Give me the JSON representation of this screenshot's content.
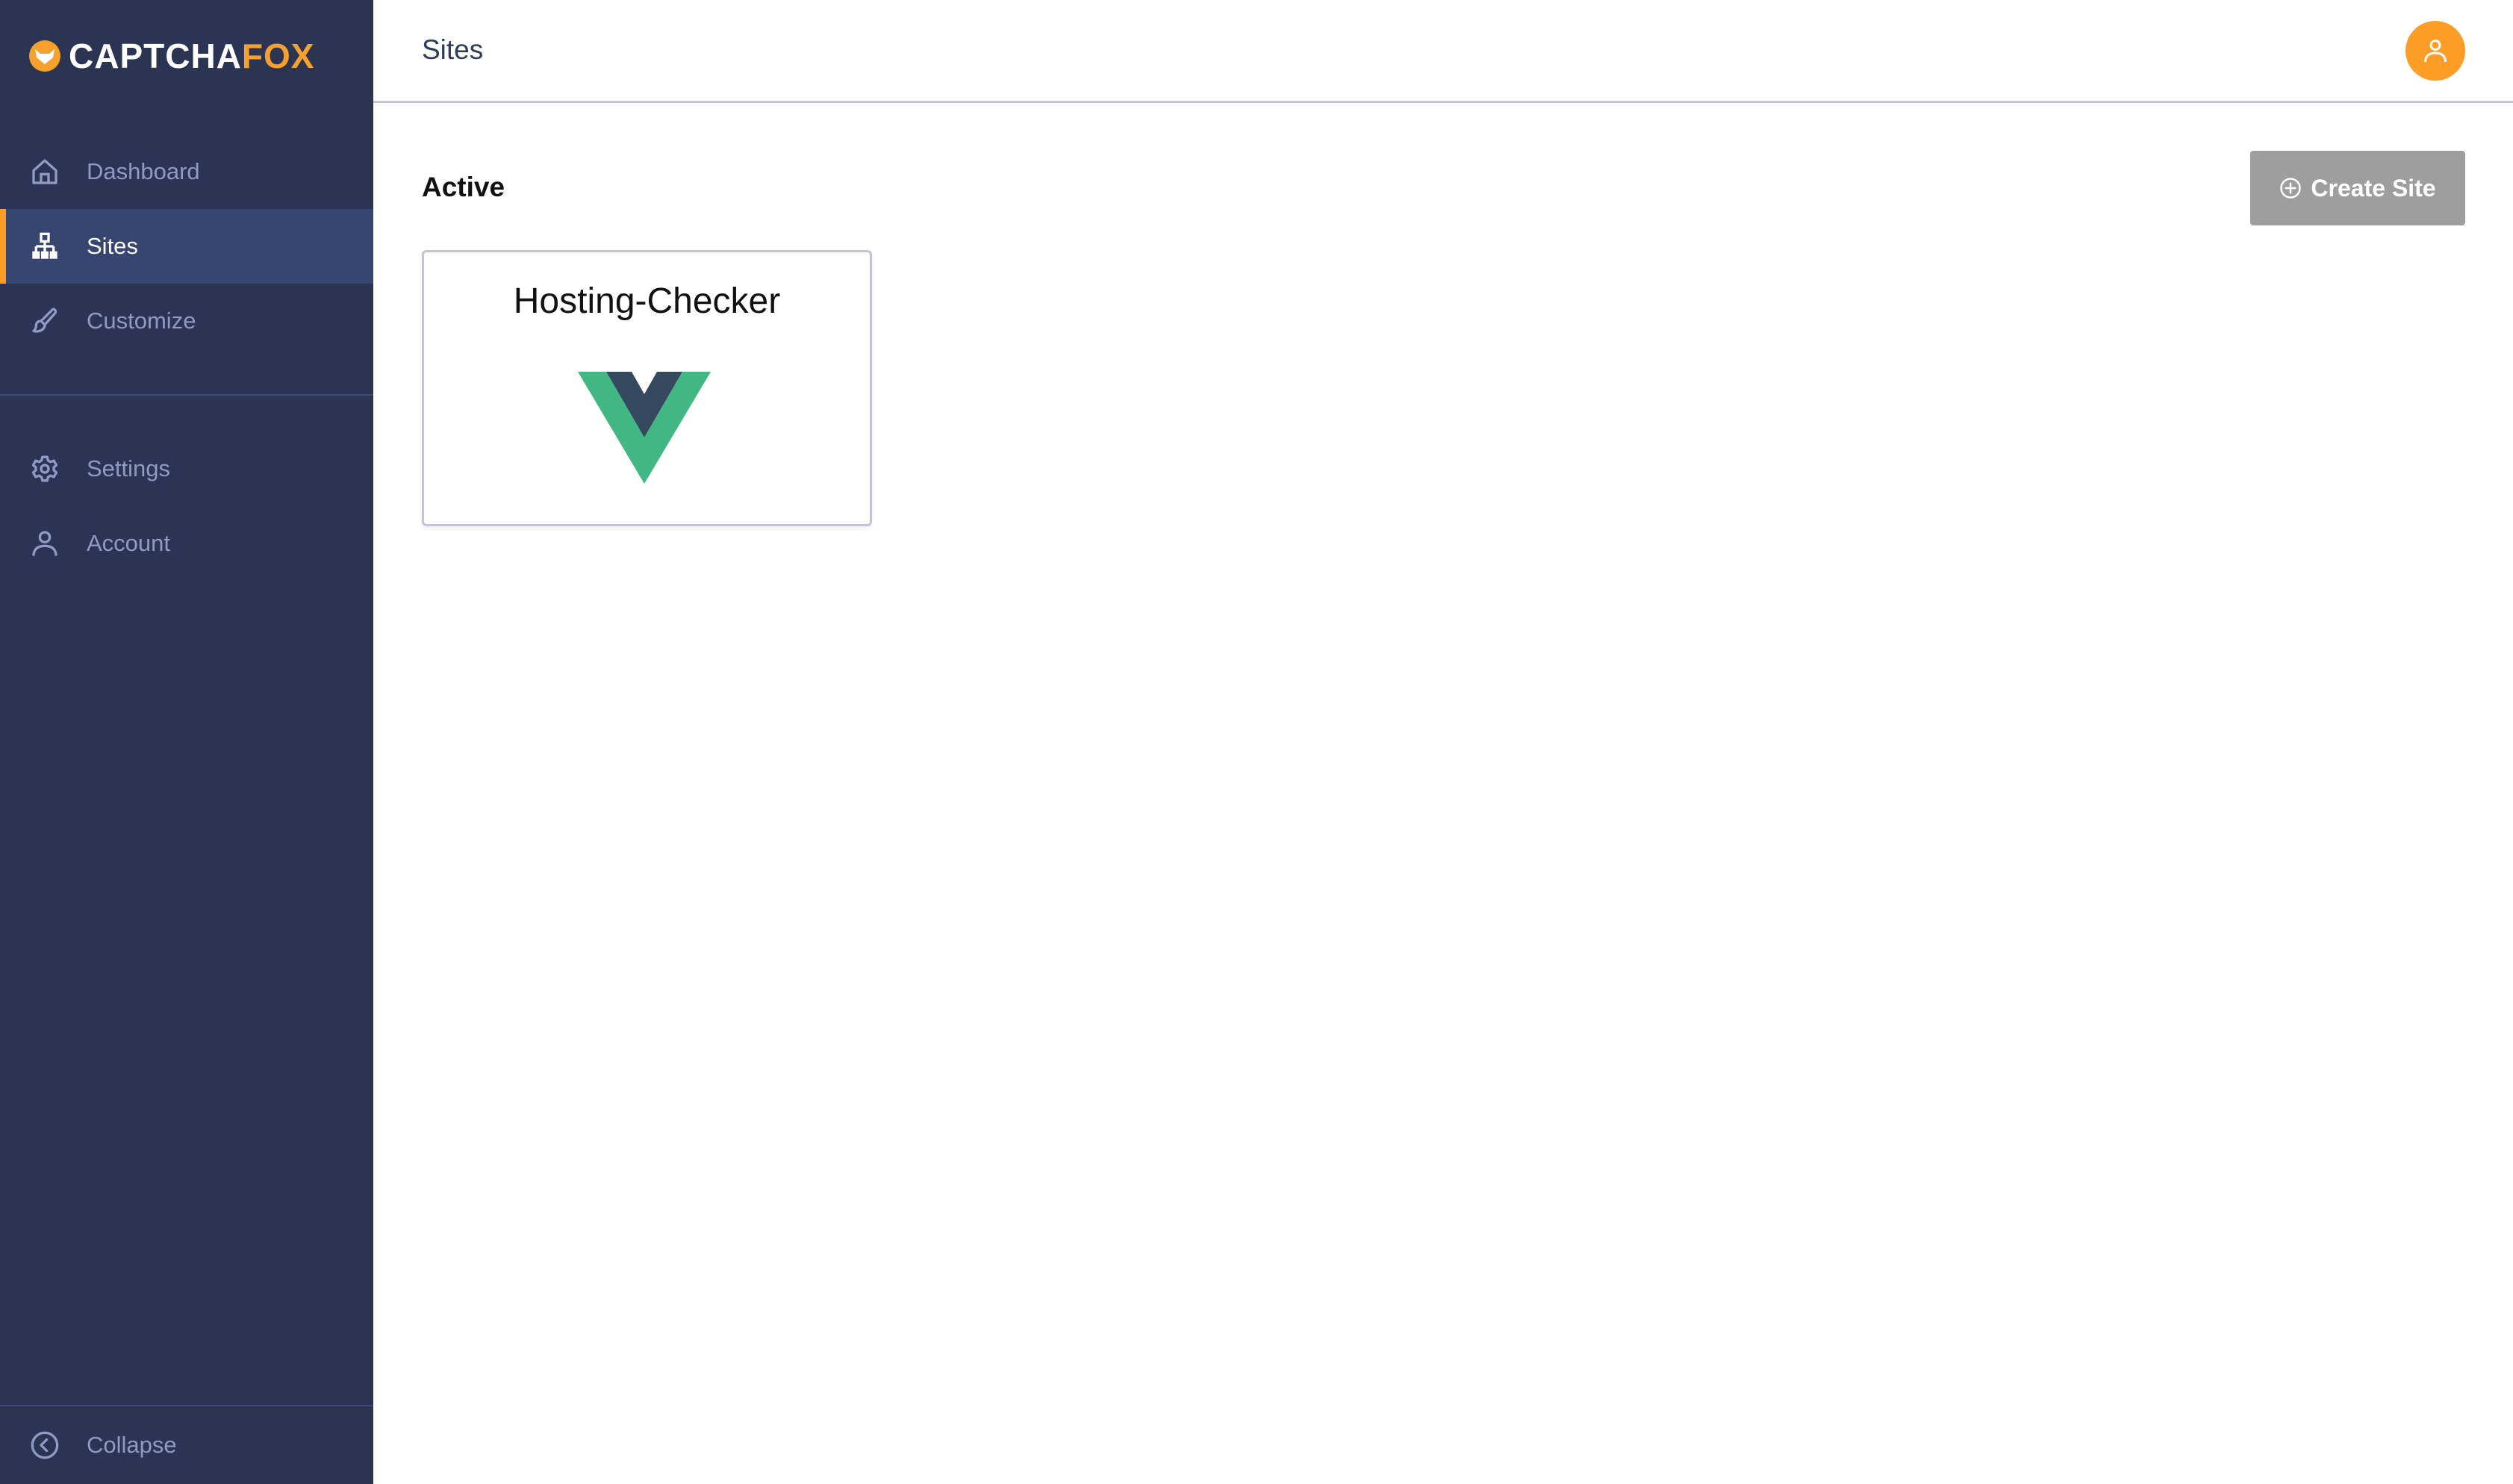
{
  "brand": {
    "name_primary": "CAPTCHA",
    "name_accent": "FOX",
    "accent_color": "#f7a02c",
    "logo_icon": "fox-icon"
  },
  "sidebar": {
    "items": [
      {
        "label": "Dashboard",
        "icon": "home-icon",
        "active": false
      },
      {
        "label": "Sites",
        "icon": "sitemap-icon",
        "active": true
      },
      {
        "label": "Customize",
        "icon": "paintbrush-icon",
        "active": false
      },
      {
        "label": "Settings",
        "icon": "gear-icon",
        "active": false
      },
      {
        "label": "Account",
        "icon": "user-icon",
        "active": false
      }
    ],
    "collapse": {
      "label": "Collapse",
      "icon": "chevron-left-circle-icon"
    }
  },
  "header": {
    "title": "Sites",
    "avatar_icon": "user-icon",
    "avatar_color": "#fd9d26"
  },
  "main": {
    "section_title": "Active",
    "create_button": {
      "label": "Create Site",
      "icon": "plus-circle-icon"
    },
    "sites": [
      {
        "name": "Hosting-Checker",
        "logo": "vue-logo"
      }
    ]
  },
  "colors": {
    "sidebar_bg": "#2b3553",
    "sidebar_active_bg": "#374670",
    "active_indicator": "#ff9c24",
    "button_disabled": "#9e9e9e"
  }
}
